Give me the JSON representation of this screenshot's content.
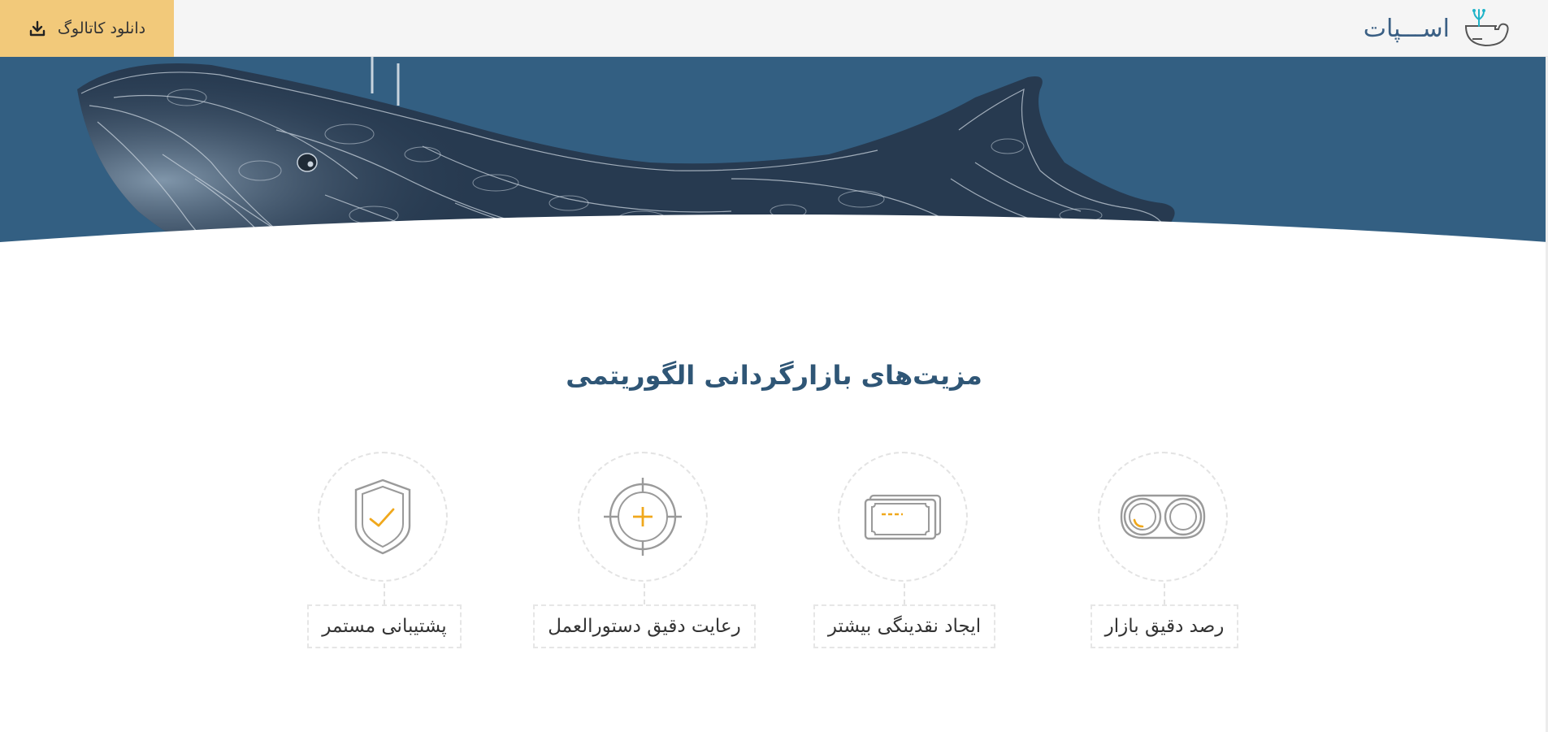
{
  "header": {
    "brand_name": "اســـپات",
    "brand_icon": "bowl-sprout-icon",
    "download_label": "دانلود کاتالوگ",
    "download_icon": "download-icon"
  },
  "hero": {
    "image": "whale-illustration",
    "background_color": "#335f82"
  },
  "section": {
    "title": "مزیت‌های بازارگردانی الگوریتمی"
  },
  "features": [
    {
      "label": "رصد دقیق بازار",
      "icon": "binoculars-icon"
    },
    {
      "label": "ایجاد نقدینگی بیشتر",
      "icon": "money-icon"
    },
    {
      "label": "رعایت دقیق دستورالعمل",
      "icon": "crosshair-icon"
    },
    {
      "label": "پشتیبانی مستمر",
      "icon": "shield-check-icon"
    }
  ],
  "colors": {
    "accent": "#f2c97a",
    "title": "#2f5676",
    "icon_gray": "#9a9a9a",
    "icon_highlight": "#f0a81c"
  }
}
